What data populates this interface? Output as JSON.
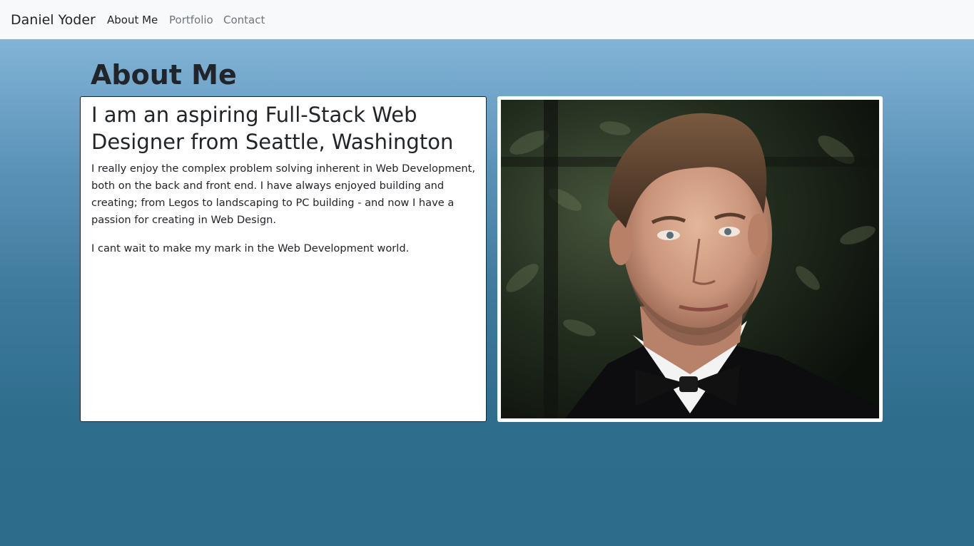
{
  "navbar": {
    "brand": "Daniel Yoder",
    "links": [
      {
        "label": "About Me",
        "active": true
      },
      {
        "label": "Portfolio",
        "active": false
      },
      {
        "label": "Contact",
        "active": false
      }
    ]
  },
  "page": {
    "title": "About Me"
  },
  "about": {
    "heading": "I am an aspiring Full-Stack Web Designer from Seattle, Washington",
    "paragraphs": [
      "I really enjoy the complex problem solving inherent in Web Development, both on the back and front end. I have always enjoyed building and creating; from Legos to landscaping to PC building - and now I have a passion for creating in Web Design.",
      "I cant wait to make my mark in the Web Development world."
    ]
  },
  "photo": {
    "subject": "portrait of a man in a black tuxedo and bow tie in front of dark foliage"
  },
  "colors": {
    "navbar_bg": "#f8f9fa",
    "gradient_top": "#82b4d7",
    "gradient_bottom": "#2e6c8c",
    "card_bg": "#ffffff"
  }
}
